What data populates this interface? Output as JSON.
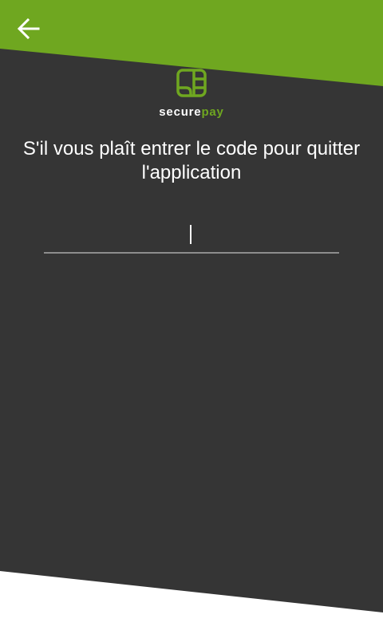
{
  "header": {
    "back_icon": "arrow-left-icon",
    "accent_color": "#6fa720"
  },
  "logo": {
    "icon": "card-chip-icon",
    "text_secure": "secure",
    "text_pay": "pay"
  },
  "prompt": {
    "text": "S'il vous plaît entrer le code pour quitter l'application"
  },
  "code_input": {
    "value": "",
    "placeholder": ""
  },
  "colors": {
    "background_dark": "#353535",
    "background_light": "#ffffff",
    "underline": "#8d8d8d"
  }
}
